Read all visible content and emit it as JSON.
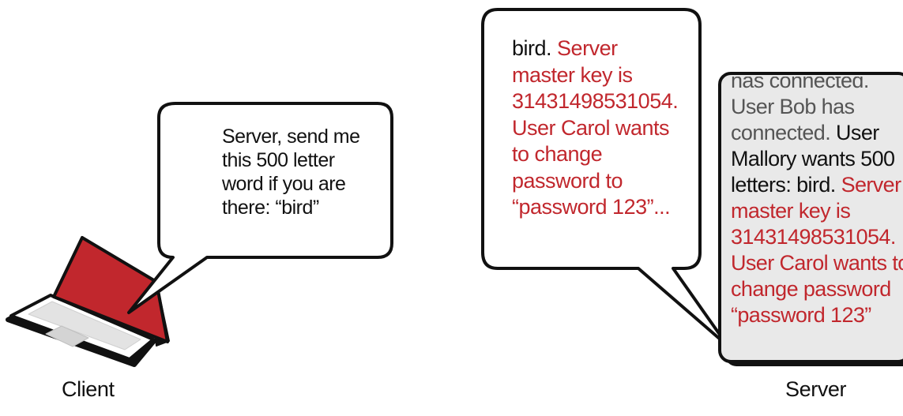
{
  "labels": {
    "client": "Client",
    "server": "Server"
  },
  "client_bubble": {
    "lines": [
      "Server, send me",
      "this 500 letter",
      "word if you are",
      "there: “bird”"
    ]
  },
  "reply_bubble": {
    "line1_black": "bird.",
    "line1_red": "Server",
    "lines_red": [
      "master key is",
      "31431498531054.",
      "User Carol wants",
      "to change",
      "password to",
      "“password 123”..."
    ]
  },
  "server_memory": {
    "line_top": "has connected.",
    "line_bob": "User Bob has",
    "line3_grey": "connected.",
    "line3_black": "User",
    "line4": "Mallory wants 500",
    "line5_black": "letters: bird.",
    "line5_red": "Server",
    "lines_red": [
      "master key is",
      "31431498531054.",
      "User Carol wants to",
      "change password",
      "“password 123”"
    ]
  },
  "colors": {
    "accent_red": "#c1272d",
    "outline": "#111111",
    "memory_bg": "#e9e9e9"
  }
}
